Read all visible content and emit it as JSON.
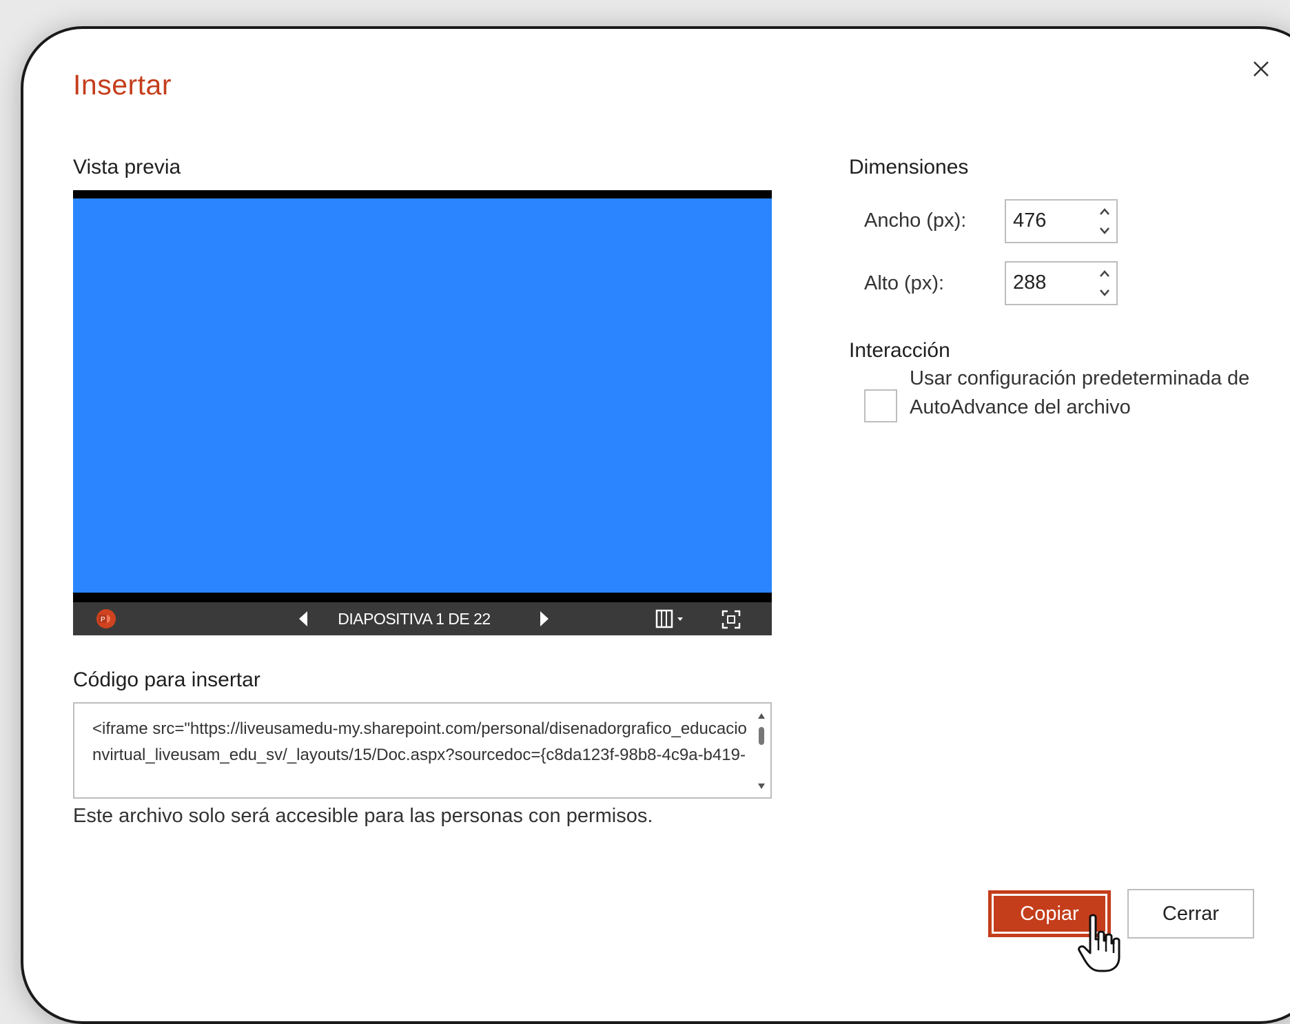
{
  "dialog": {
    "title": "Insertar",
    "close_label": "×"
  },
  "preview": {
    "heading": "Vista previa",
    "slide_color": "#2a85ff",
    "slide_counter": "DIAPOSITIVA 1 DE 22",
    "icons": [
      "powerpoint-logo-icon",
      "previous-slide-icon",
      "next-slide-icon",
      "layout-menu-icon",
      "fullscreen-icon"
    ]
  },
  "embed": {
    "heading": "Código para insertar",
    "code": "<iframe src=\"https://liveusamedu-my.sharepoint.com/personal/disenadorgrafico_educacionvirtual_liveusam_edu_sv/_layouts/15/Doc.aspx?sourcedoc={c8da123f-98b8-4c9a-b419-",
    "note": "Este archivo solo será accesible para las personas con permisos."
  },
  "dimensions": {
    "heading": "Dimensiones",
    "width_label": "Ancho (px):",
    "width_value": "476",
    "height_label": "Alto (px):",
    "height_value": "288"
  },
  "interaction": {
    "heading": "Interacción",
    "checkbox_label": "Usar configuración predeterminada de AutoAdvance del archivo",
    "checked": false
  },
  "buttons": {
    "copy": "Copiar",
    "close": "Cerrar"
  },
  "colors": {
    "accent": "#c43e1c",
    "slide": "#2a85ff"
  }
}
